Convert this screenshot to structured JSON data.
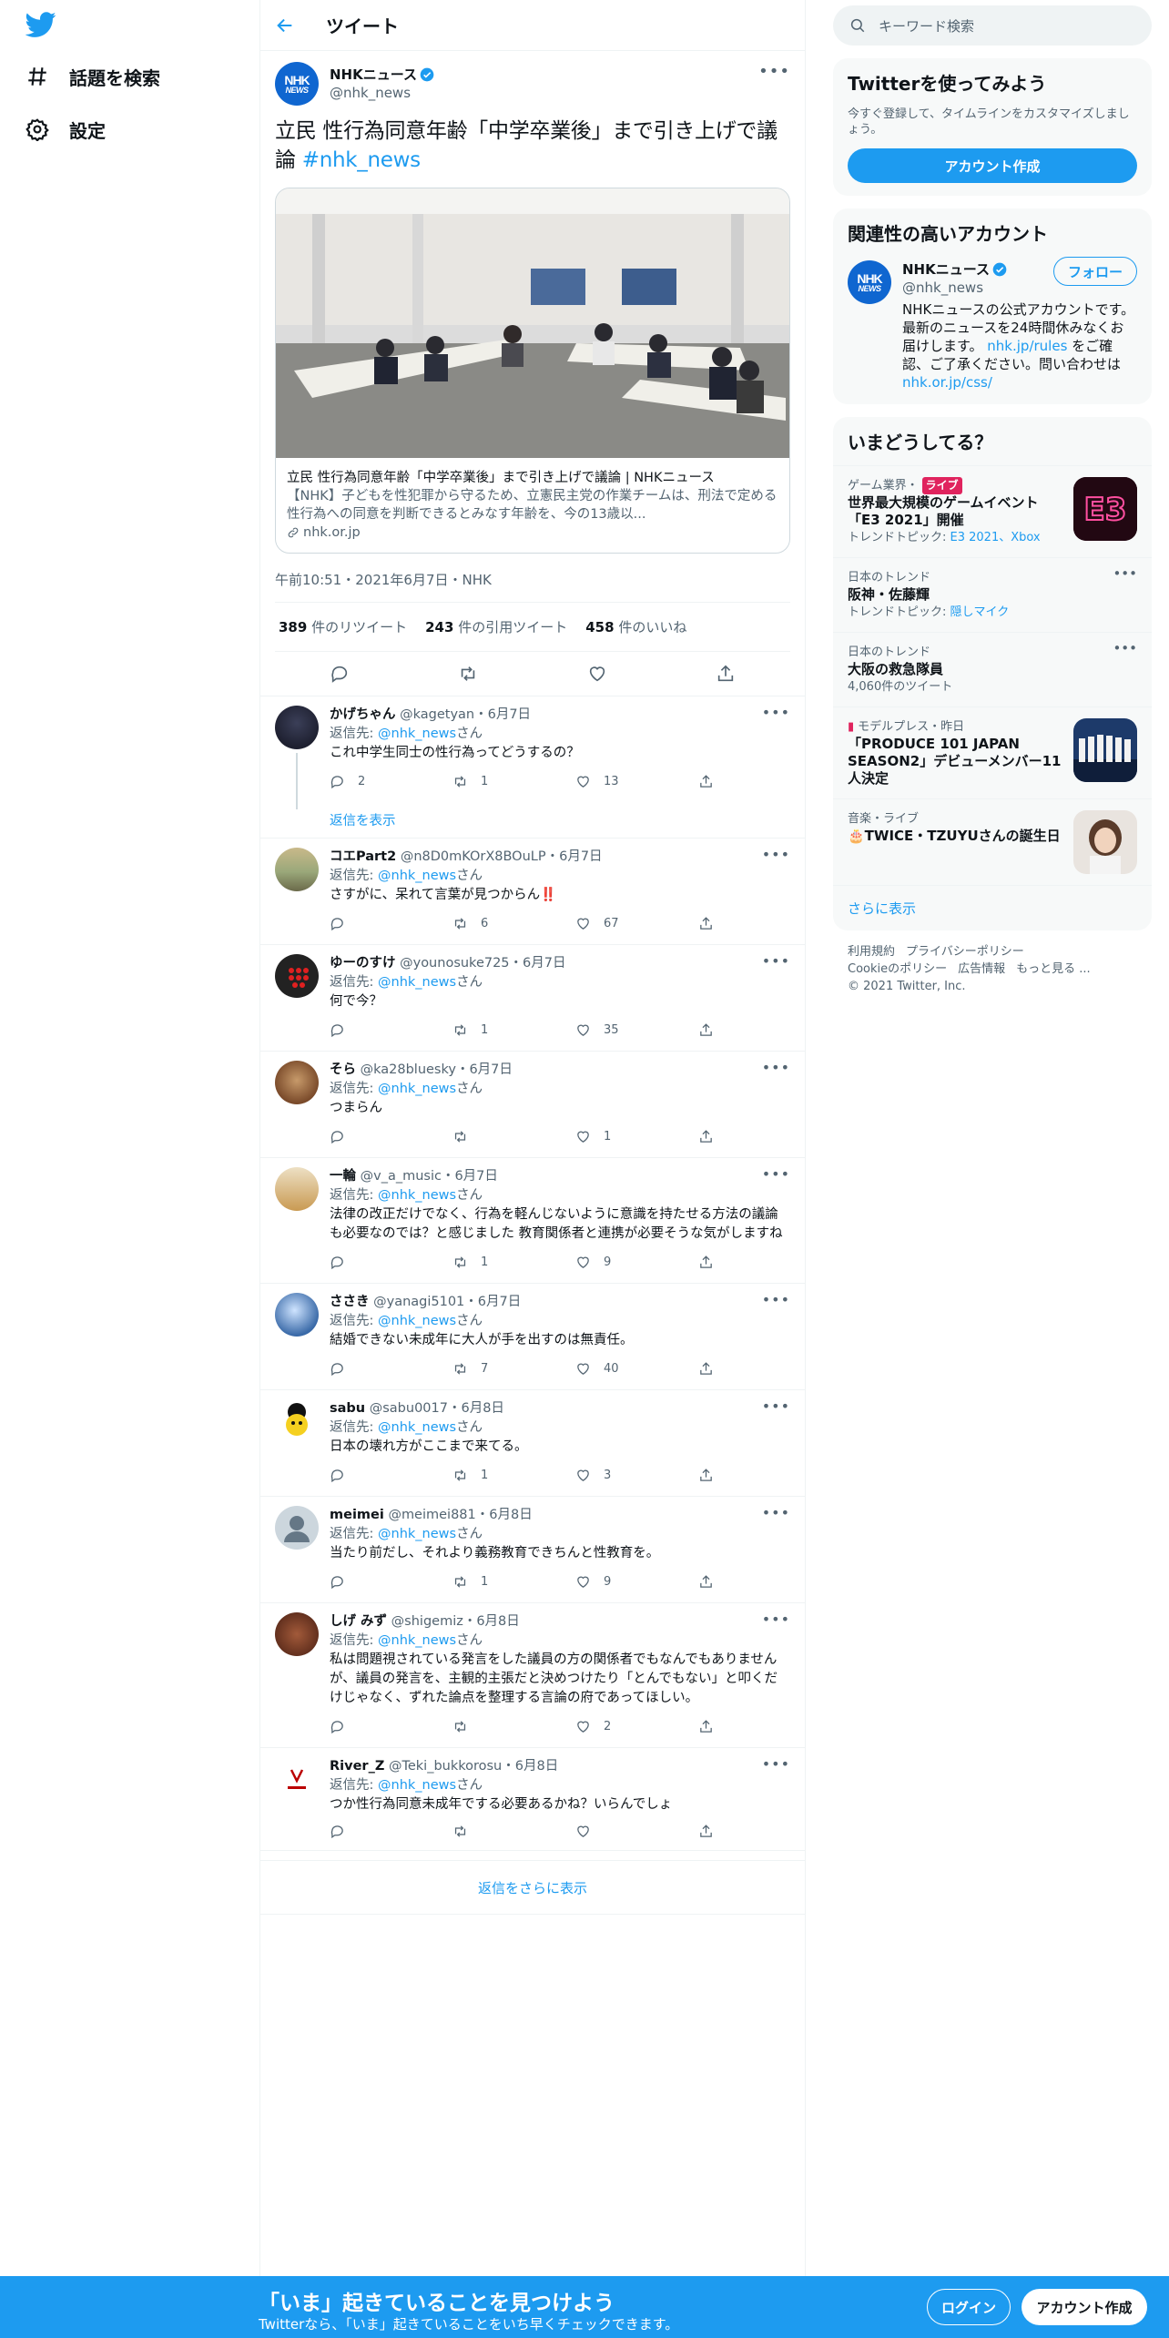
{
  "colors": {
    "accent": "#1d9bf0",
    "like": "#f91880",
    "live": "#e0245e",
    "bottom_bar": "#1d9bf0"
  },
  "nav": {
    "items": [
      {
        "label": "話題を検索",
        "icon": "hashtag-icon"
      },
      {
        "label": "設定",
        "icon": "gear-icon"
      }
    ]
  },
  "header": {
    "title": "ツイート"
  },
  "main_tweet": {
    "author": "NHKニュース",
    "handle": "@nhk_news",
    "avatar_text_1": "NHK",
    "avatar_text_2": "NEWS",
    "text": "立民 性行為同意年齢「中学卒業後」まで引き上げで議論 ",
    "hashtag": "#nhk_news",
    "card": {
      "title": "立民 性行為同意年齢「中学卒業後」まで引き上げで議論 | NHKニュース",
      "description": "【NHK】子どもを性犯罪から守るため、立憲民主党の作業チームは、刑法で定める性行為への同意を判断できるとみなす年齢を、今の13歳以...",
      "domain": "nhk.or.jp"
    },
    "meta": "午前10:51・2021年6月7日・NHK",
    "stats": {
      "retweets": "389",
      "retweets_label": "件のリツイート",
      "quotes": "243",
      "quotes_label": "件の引用ツイート",
      "likes": "458",
      "likes_label": "件のいいね"
    }
  },
  "replies": [
    {
      "name": "かげちゃん",
      "meta": "@kagetyan・6月7日",
      "to_prefix": "返信先: ",
      "to": "@nhk_news",
      "to_suffix": "さん",
      "text": "これ中学生同士の性行為ってどうするの？",
      "reply": "2",
      "rt": "1",
      "like": "13",
      "thread": "返信を表示"
    },
    {
      "name": "コエPart2",
      "meta": "@n8D0mKOrX8BOuLP・6月7日",
      "to_prefix": "返信先: ",
      "to": "@nhk_news",
      "to_suffix": "さん",
      "text": "さすがに、呆れて言葉が見つからん‼️",
      "reply": "",
      "rt": "6",
      "like": "67"
    },
    {
      "name": "ゆーのすけ",
      "meta": "@younosuke725・6月7日",
      "to_prefix": "返信先: ",
      "to": "@nhk_news",
      "to_suffix": "さん",
      "text": "何で今？",
      "reply": "",
      "rt": "1",
      "like": "35"
    },
    {
      "name": "そら",
      "meta": "@ka28bluesky・6月7日",
      "to_prefix": "返信先: ",
      "to": "@nhk_news",
      "to_suffix": "さん",
      "text": "つまらん",
      "reply": "",
      "rt": "",
      "like": "1"
    },
    {
      "name": "一輪",
      "meta": "@v_a_music・6月7日",
      "to_prefix": "返信先: ",
      "to": "@nhk_news",
      "to_suffix": "さん",
      "text": "法律の改正だけでなく、行為を軽んじないように意識を持たせる方法の議論も必要なのでは？と感じました 教育関係者と連携が必要そうな気がしますね",
      "reply": "",
      "rt": "1",
      "like": "9"
    },
    {
      "name": "ささき",
      "meta": "@yanagi5101・6月7日",
      "to_prefix": "返信先: ",
      "to": "@nhk_news",
      "to_suffix": "さん",
      "text": "結婚できない未成年に大人が手を出すのは無責任。",
      "reply": "",
      "rt": "7",
      "like": "40"
    },
    {
      "name": "sabu",
      "meta": "@sabu0017・6月8日",
      "to_prefix": "返信先: ",
      "to": "@nhk_news",
      "to_suffix": "さん",
      "text": "日本の壊れ方がここまで来てる。",
      "reply": "",
      "rt": "1",
      "like": "3"
    },
    {
      "name": "meimei",
      "meta": "@meimei881・6月8日",
      "to_prefix": "返信先: ",
      "to": "@nhk_news",
      "to_suffix": "さん",
      "text": "当たり前だし、それより義務教育できちんと性教育を。",
      "reply": "",
      "rt": "1",
      "like": "9"
    },
    {
      "name": "しげ みず",
      "meta": "@shigemiz・6月8日",
      "to_prefix": "返信先: ",
      "to": "@nhk_news",
      "to_suffix": "さん",
      "text": "私は問題視されている発言をした議員の方の関係者でもなんでもありませんが、議員の発言を、主観的主張だと決めつけたり「とんでもない」と叩くだけじゃなく、ずれた論点を整理する言論の府であってほしい。",
      "reply": "",
      "rt": "",
      "like": "2"
    },
    {
      "name": "River_Z",
      "meta": "@Teki_bukkorosu・6月8日",
      "to_prefix": "返信先: ",
      "to": "@nhk_news",
      "to_suffix": "さん",
      "text": "つか性行為同意未成年でする必要あるかね？いらんでしょ",
      "reply": "",
      "rt": "",
      "like": ""
    }
  ],
  "more_replies": "返信をさらに表示",
  "search": {
    "placeholder": "キーワード検索"
  },
  "signup_panel": {
    "title": "Twitterを使ってみよう",
    "subtitle": "今すぐ登録して、タイムラインをカスタマイズしましょう。",
    "button": "アカウント作成"
  },
  "related": {
    "title": "関連性の高いアカウント",
    "name": "NHKニュース",
    "handle": "@nhk_news",
    "follow": "フォロー",
    "bio_1": "NHKニュースの公式アカウントです。最新のニュースを24時間休みなくお届けします。",
    "bio_link": "nhk.jp/rules",
    "bio_2": " をご確認、ご了承ください。問い合わせは",
    "bio_link2": "nhk.or.jp/css/"
  },
  "trends": {
    "title": "いまどうしてる？",
    "items": [
      {
        "category": "ゲーム業界・",
        "live": "ライブ",
        "title": "世界最大規模のゲームイベント「E3 2021」開催",
        "meta_prefix": "トレンドトピック: ",
        "meta_link": "E3 2021、Xbox",
        "image": "E3"
      },
      {
        "category": "日本のトレンド",
        "title": "阪神・佐藤輝",
        "meta_prefix": "トレンドトピック: ",
        "meta_link": "隠しマイク"
      },
      {
        "category": "日本のトレンド",
        "title": "大阪の救急隊員",
        "meta_prefix": "4,060件のツイート",
        "meta_link": ""
      },
      {
        "category": "モデルプレス・昨日",
        "title": "「PRODUCE 101 JAPAN SEASON2」デビューメンバー11人決定"
      },
      {
        "category": "音楽・ライブ",
        "title": "🎂TWICE・TZUYUさんの誕生日"
      }
    ],
    "show_more": "さらに表示"
  },
  "footer": {
    "links": [
      "利用規約",
      "プライバシーポリシー",
      "Cookieのポリシー",
      "広告情報",
      "もっと見る ..."
    ],
    "copyright": "© 2021 Twitter, Inc."
  },
  "bottom_bar": {
    "title": "「いま」起きていることを見つけよう",
    "subtitle": "Twitterなら、「いま」起きていることをいち早くチェックできます。",
    "login": "ログイン",
    "signup": "アカウント作成"
  }
}
